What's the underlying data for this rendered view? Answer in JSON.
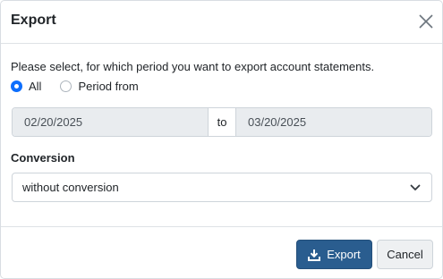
{
  "dialog": {
    "title": "Export",
    "close_icon": "close-icon"
  },
  "period": {
    "prompt": "Please select, for which period you want to export account statements.",
    "options": [
      {
        "label": "All",
        "selected": true
      },
      {
        "label": "Period from",
        "selected": false
      }
    ],
    "date_from": "02/20/2025",
    "separator": "to",
    "date_to": "03/20/2025"
  },
  "conversion": {
    "label": "Conversion",
    "selected": "without conversion",
    "chevron_icon": "chevron-down-icon"
  },
  "footer": {
    "export_label": "Export",
    "export_icon": "download-icon",
    "cancel_label": "Cancel"
  },
  "colors": {
    "primary": "#2a5d8f",
    "radio_checked": "#0d6efd",
    "disabled_field": "#e9ecef"
  }
}
